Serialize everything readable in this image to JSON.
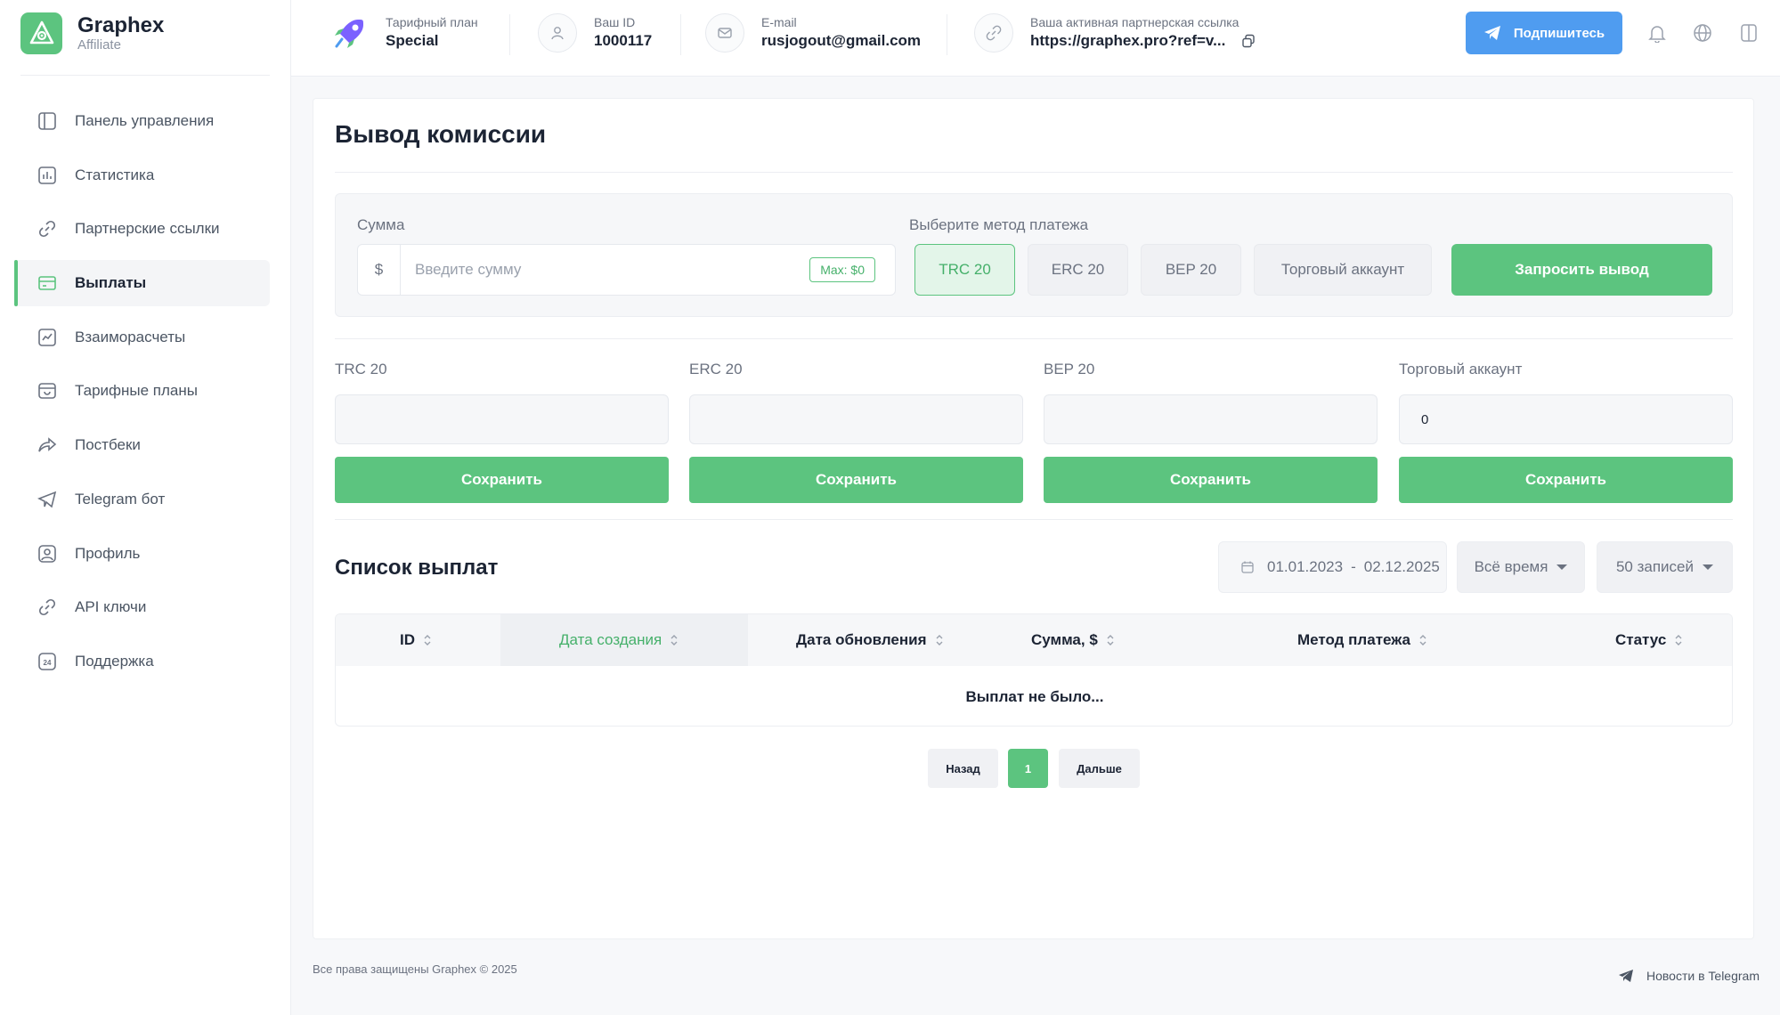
{
  "brand": {
    "name": "Graphex",
    "subtitle": "Affiliate"
  },
  "sidebar": {
    "items": [
      {
        "label": "Панель управления",
        "icon": "dashboard-icon"
      },
      {
        "label": "Статистика",
        "icon": "chart-icon"
      },
      {
        "label": "Партнерские ссылки",
        "icon": "link-icon"
      },
      {
        "label": "Выплаты",
        "icon": "payout-card-icon",
        "active": true
      },
      {
        "label": "Взаиморасчеты",
        "icon": "trend-icon"
      },
      {
        "label": "Тарифные планы",
        "icon": "plans-icon"
      },
      {
        "label": "Постбеки",
        "icon": "share-icon"
      },
      {
        "label": "Telegram бот",
        "icon": "telegram-icon"
      },
      {
        "label": "Профиль",
        "icon": "profile-icon"
      },
      {
        "label": "API ключи",
        "icon": "api-link-icon"
      },
      {
        "label": "Поддержка",
        "icon": "support-24-icon"
      }
    ]
  },
  "topbar": {
    "plan": {
      "label": "Тарифный план",
      "value": "Special"
    },
    "user_id": {
      "label": "Ваш ID",
      "value": "1000117"
    },
    "email": {
      "label": "E-mail",
      "value": "rusjogout@gmail.com"
    },
    "ref_link": {
      "label": "Ваша активная партнерская ссылка",
      "value": "https://graphex.pro?ref=v..."
    },
    "subscribe_label": "Подпишитесь"
  },
  "page": {
    "title": "Вывод комиссии",
    "amount_label": "Сумма",
    "currency_symbol": "$",
    "amount_placeholder": "Введите сумму",
    "max_badge": "Max: $0",
    "method_label": "Выберите метод платежа",
    "methods": [
      "TRC 20",
      "ERC 20",
      "BEP 20",
      "Торговый аккаунт"
    ],
    "selected_method": "TRC 20",
    "request_button": "Запросить вывод"
  },
  "wallets": [
    {
      "label": "TRC 20",
      "value": "",
      "save": "Сохранить"
    },
    {
      "label": "ERC 20",
      "value": "",
      "save": "Сохранить"
    },
    {
      "label": "BEP 20",
      "value": "",
      "save": "Сохранить"
    },
    {
      "label": "Торговый аккаунт",
      "value": "0",
      "save": "Сохранить"
    }
  ],
  "payouts": {
    "title": "Список выплат",
    "date_from": "01.01.2023",
    "date_sep": "-",
    "date_to": "02.12.2025",
    "period": "Всё время",
    "page_size": "50 записей",
    "columns": [
      "ID",
      "Дата создания",
      "Дата обновления",
      "Сумма, $",
      "Метод платежа",
      "Статус"
    ],
    "sorted_column": "Дата создания",
    "empty_text": "Выплат не было..."
  },
  "pagination": {
    "prev": "Назад",
    "page": "1",
    "next": "Дальше"
  },
  "footer": {
    "copyright": "Все права защищены Graphex © 2025",
    "news": "Новости в Telegram"
  },
  "colors": {
    "accent": "#5cc47f",
    "telegram_blue": "#4f9cf0",
    "text": "#1c2434",
    "muted": "#6b7280"
  }
}
